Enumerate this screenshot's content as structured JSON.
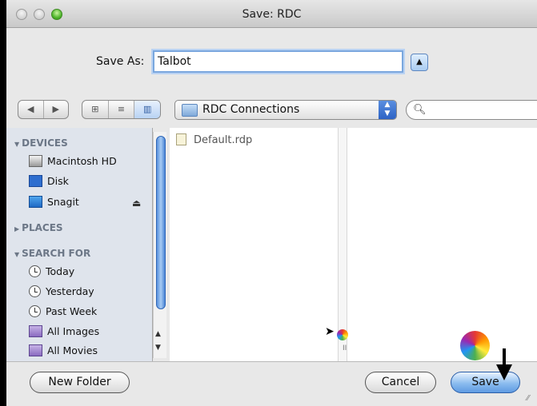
{
  "window": {
    "title": "Save: RDC"
  },
  "save_as": {
    "label": "Save As:",
    "value": "Talbot"
  },
  "toolbar": {
    "back_icon": "◀",
    "forward_icon": "▶",
    "view_icons": [
      "⊞",
      "≡",
      "▥"
    ],
    "location": "RDC Connections",
    "search_value": ""
  },
  "sidebar": {
    "devices_header": "DEVICES",
    "devices": [
      {
        "label": "Macintosh HD",
        "icon": "hard-drive-icon"
      },
      {
        "label": "Disk",
        "icon": "disk-icon"
      },
      {
        "label": "Snagit",
        "icon": "snagit-drive-icon"
      }
    ],
    "places_header": "PLACES",
    "search_header": "SEARCH FOR",
    "searches": [
      {
        "label": "Today",
        "icon": "clock-icon"
      },
      {
        "label": "Yesterday",
        "icon": "clock-icon"
      },
      {
        "label": "Past Week",
        "icon": "clock-icon"
      },
      {
        "label": "All Images",
        "icon": "smart-folder-icon"
      },
      {
        "label": "All Movies",
        "icon": "smart-folder-icon"
      }
    ]
  },
  "files": [
    {
      "name": "Default.rdp"
    }
  ],
  "buttons": {
    "new_folder": "New Folder",
    "cancel": "Cancel",
    "save": "Save"
  }
}
